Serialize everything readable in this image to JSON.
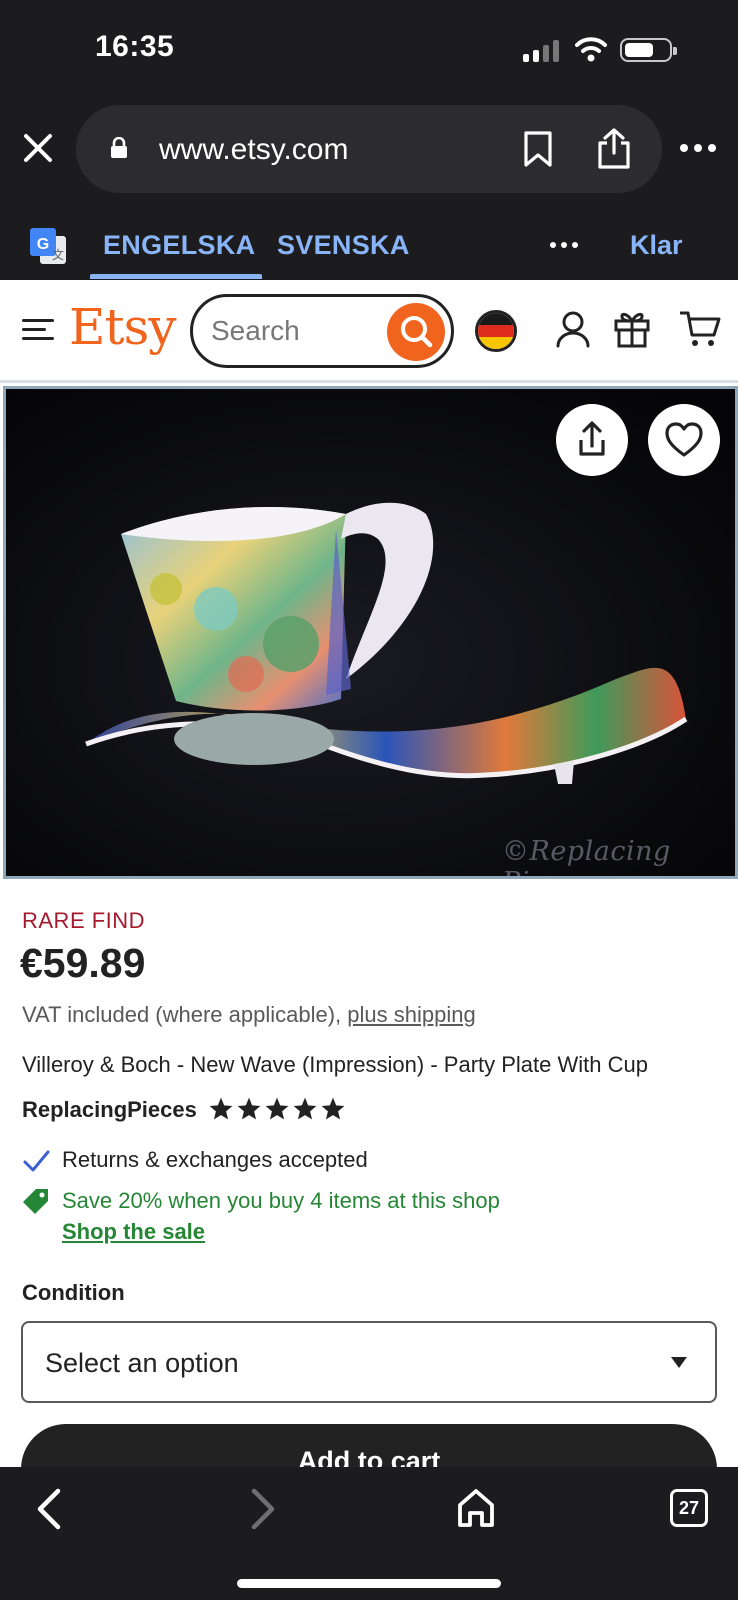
{
  "status_bar": {
    "time": "16:35"
  },
  "browser": {
    "url": "www.etsy.com",
    "tabs_count": "27"
  },
  "translate_bar": {
    "source_lang": "ENGELSKA",
    "target_lang": "SVENSKA",
    "done_label": "Klar"
  },
  "etsy_header": {
    "logo": "Etsy",
    "search_placeholder": "Search",
    "region_flag": "germany-flag"
  },
  "product_image": {
    "watermark": "©Replacing Pieces"
  },
  "product": {
    "badge": "RARE FIND",
    "price": "€59.89",
    "vat_text": "VAT included (where applicable), ",
    "shipping_link": "plus shipping",
    "title": "Villeroy & Boch - New Wave (Impression) - Party Plate With Cup",
    "seller": "ReplacingPieces",
    "rating_stars": 5,
    "returns_text": "Returns & exchanges accepted",
    "sale_text": "Save 20% when you buy 4 items at this shop",
    "sale_link": "Shop the sale"
  },
  "options": {
    "condition_label": "Condition",
    "condition_selected": "Select an option"
  },
  "actions": {
    "add_to_cart": "Add to cart"
  },
  "colors": {
    "etsy_orange": "#f1641e",
    "rare_red": "#a61a2e",
    "sale_green": "#258635",
    "translate_blue": "#8ab4f8",
    "chrome_dark": "#1c1c1e"
  }
}
